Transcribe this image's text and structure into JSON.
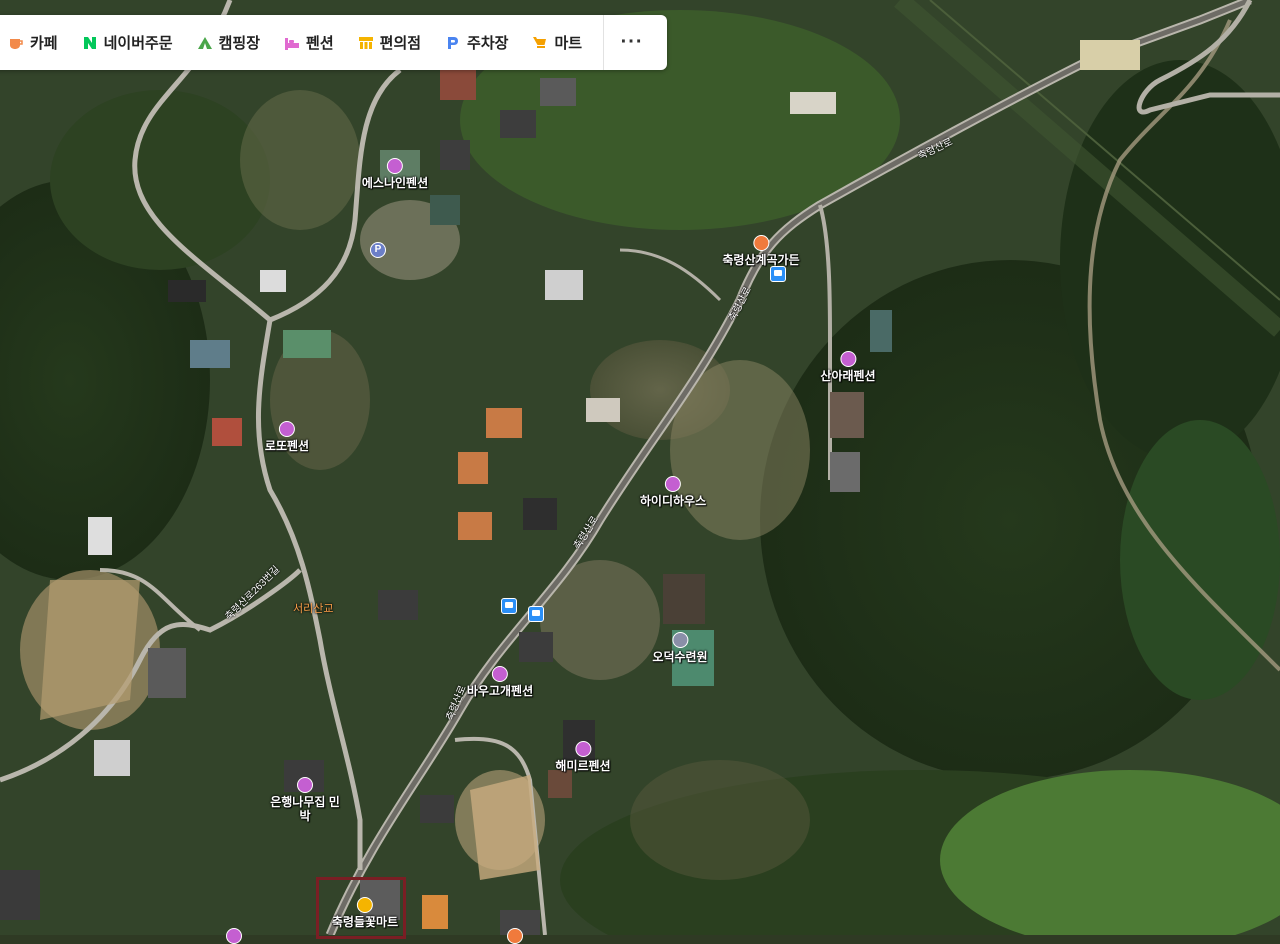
{
  "category_bar": {
    "items": [
      {
        "label": "카페",
        "icon": "cafe-cup-icon",
        "color": "#f28a4a"
      },
      {
        "label": "네이버주문",
        "icon": "naver-n-icon",
        "color": "#03c75a"
      },
      {
        "label": "캠핑장",
        "icon": "camping-tent-icon",
        "color": "#4aa64a"
      },
      {
        "label": "펜션",
        "icon": "pension-bed-icon",
        "color": "#e06ad0"
      },
      {
        "label": "편의점",
        "icon": "convenience-store-icon",
        "color": "#f5b400"
      },
      {
        "label": "주차장",
        "icon": "parking-p-icon",
        "color": "#4a84f0"
      },
      {
        "label": "마트",
        "icon": "mart-cart-icon",
        "color": "#f5a000"
      }
    ],
    "more_label": "···"
  },
  "pois": {
    "esnine": {
      "label": "에스나인펜션",
      "kind": "pension"
    },
    "chukryeong_garden": {
      "label": "축령산계곡가든",
      "kind": "restaurant"
    },
    "sanarae": {
      "label": "산아래펜션",
      "kind": "pension"
    },
    "lotto": {
      "label": "로또펜션",
      "kind": "pension"
    },
    "highty": {
      "label": "하이디하우스",
      "kind": "pension"
    },
    "odeok": {
      "label": "오덕수련원",
      "kind": "facility"
    },
    "bawoogae": {
      "label": "바우고개펜션",
      "kind": "pension"
    },
    "haemireu": {
      "label": "해미르펜션",
      "kind": "pension"
    },
    "eunhaeng": {
      "label": "은행나무집 민박",
      "kind": "pension"
    },
    "mart": {
      "label": "축령들꽃마트",
      "kind": "mart"
    }
  },
  "road_labels": {
    "chukryeongsan_ro_top": "축령산로",
    "chukryeongsan_ro_mid": "축령산로",
    "chukryeongsan_ro_63": "축령산로263번길",
    "road_small_a": "축령산로",
    "road_small_b": "축령산로",
    "seoriteo_bridge": "서리산교"
  },
  "colors": {
    "pension": "#c45fd1",
    "restaurant": "#f07a3c",
    "facility": "#8a8fa8",
    "mart": "#f5b400",
    "bus": "#2b8ff7",
    "highlight": "#7a1e24"
  }
}
